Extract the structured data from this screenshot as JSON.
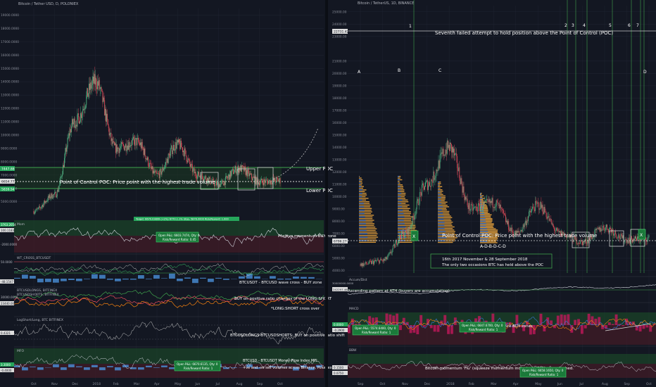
{
  "left_panel": {
    "symbol_title": "Bitcoin / Tether USD, D, POLONIEX",
    "price_ticks": [
      "19000.0000",
      "18000.0000",
      "17000.0000",
      "16000.0000",
      "15000.0000",
      "14000.0000",
      "13000.0000",
      "12000.0000",
      "11000.0000",
      "10000.0000",
      "9000.0000",
      "8000.0000",
      "7000.0000",
      "6000.0000",
      "5000.0000"
    ],
    "price_badges": [
      "7447.88",
      "6654.77",
      "5839.94"
    ],
    "x_ticks": [
      "Oct",
      "Nov",
      "Dec",
      "2018",
      "Feb",
      "Mar",
      "Apr",
      "May",
      "Jun",
      "Jul",
      "Aug",
      "Sep",
      "Oct"
    ],
    "poc_text": "Point of Control POC: Price point with the highest trade volume",
    "upper_poc": "Upper POC",
    "lower_poc": "Lower POC",
    "indicators": [
      {
        "title": "Mom",
        "badge": "3763.2054",
        "badge2": "100.1183",
        "left_tick": "-2000.0000",
        "note": "Positive momentum BUY zone",
        "box_lines": [
          "Open P&L: 6603.7474, Qty: 0",
          "Risk/Reward Ratio: 0.45"
        ],
        "top_note": "Target: 6670.03899 (+2%) 6770.1.1% Stop, 5876.0000 Risk/Reward: 1.000"
      },
      {
        "title": "WT_CROSS_BTCUSDT",
        "left_tick": "50.0000",
        "badge": "-48.1547",
        "note": "BTCUSDT - BTCUSD wave cross - BUY zone"
      },
      {
        "title": "BTCUSDLONGS, BITFINEX",
        "title2": "BTCUSDSHORTS, BITFINEX",
        "left_tick": "30000.0000",
        "badge": "23440.00",
        "note": "BUY on positive ratio changes of the LONG:SHORT",
        "note2": "*LONG:SHORT cross over"
      },
      {
        "title": "LogShort/Long, BTC BITFINEX",
        "badge": "0.4321",
        "note": "BTCUSDLONGS-BTCUSDSHORTS: BUY on positive ratio shift"
      },
      {
        "title": "MFO",
        "badge": "3.3000",
        "badge2": "-0.4000",
        "note": "BTCUSD - BTCUSDT Money Flow Index MFI",
        "note2": "+ve and -ve sell volumes across Binance, Poloniex, Bitfinex",
        "box_lines": [
          "Open P&L: 6670.6135, Qty: 0",
          "Risk/Reward Ratio: 1"
        ]
      }
    ]
  },
  "right_panel": {
    "symbol_title": "Bitcoin / TetherUS, 1D, BINANCE",
    "price_ticks": [
      "25000.00",
      "24000.00",
      "23000.00",
      "21000.00",
      "20000.00",
      "19000.00",
      "18000.00",
      "17000.00",
      "16000.00",
      "15000.00",
      "14000.00",
      "13000.00",
      "12000.00",
      "11000.00",
      "10000.00",
      "9000.00",
      "8000.00",
      "7000.00",
      "6000.00",
      "5000.00",
      "4000.00"
    ],
    "price_badges": [
      "22731.42",
      "6796.27"
    ],
    "x_ticks": [
      "Sep",
      "Oct",
      "Nov",
      "Dec",
      "2018",
      "Feb",
      "Mar",
      "Apr",
      "May",
      "Jun",
      "Jul",
      "Aug",
      "Sep",
      "Oct"
    ],
    "phase_letters": [
      "A",
      "B",
      "C",
      "D"
    ],
    "attempt_numbers": [
      "1",
      "2",
      "3",
      "4",
      "5",
      "6",
      "7"
    ],
    "seventh_text": "Seventh failed attempt to hold position above the Point of Control (POC)",
    "poc_text": "Point of Control POC: Price point with the highest trade volume",
    "sequence_text": "A-D-B-D-C-D",
    "box_text_1": "16th 2017 November & 28 September 2018",
    "box_text_2": "The only two occasions BTC has held above the POC",
    "x_marks": [
      "X",
      "X"
    ],
    "indicators": [
      {
        "title": "Accum/Dist",
        "left_tick": "30000000.0000",
        "badge": "242297.4611",
        "note": "Ascending pattern at ATH (buyers are accumulating)"
      },
      {
        "title": "MACD",
        "badge": "0.0000",
        "badge2": "-0.2900",
        "note": "Convergence BUY zones",
        "box_lines": [
          "Open P&L: 5574.6400, Qty: 0",
          "Risk/Reward Ratio: 1"
        ],
        "box2_lines": [
          "Open P&L: 6647.6700, Qty: 0",
          "Risk/Reward Ratio: 1"
        ]
      },
      {
        "title": "BBW",
        "badge": "0.1500",
        "badge2": "0.0750",
        "note": "Bitcoin momentum 'Fiu' (squeeze momentum indicator) - BUY zone reached.",
        "box_lines": [
          "Open P&L: 6658.1650, Qty: 0",
          "Risk/Reward Ratio: 1"
        ]
      }
    ]
  },
  "colors": {
    "background": "#131722",
    "grid": "#1e2330",
    "up_candle": "#53b987",
    "down_candle": "#eb4d5c",
    "volume_profile": "#e8a33d",
    "volume_profile_blue": "#3c78d8",
    "green_zone": "#1c4d2a",
    "red_zone": "#4d1c28",
    "poc_line": "#c8c8c8",
    "green_badge": "#26a65b",
    "text": "#d1d4dc"
  },
  "chart_data": [
    {
      "type": "line",
      "title": "Bitcoin / Tether USD, D, POLONIEX",
      "x": [
        "Oct",
        "Nov",
        "Dec",
        "2018",
        "Feb",
        "Mar",
        "Apr",
        "May",
        "Jun",
        "Jul",
        "Aug",
        "Sep",
        "Oct"
      ],
      "series": [
        {
          "values": [
            4300,
            5500,
            11000,
            14000,
            9000,
            9500,
            7000,
            9300,
            7000,
            6300,
            7500,
            6500,
            6600
          ]
        }
      ],
      "ylim": [
        4300,
        19500
      ]
    },
    {
      "type": "line",
      "title": "Bitcoin / TetherUS, 1D, BINANCE",
      "x": [
        "Sep",
        "Oct",
        "Nov",
        "Dec",
        "2018",
        "Feb",
        "Mar",
        "Apr",
        "May",
        "Jun",
        "Jul",
        "Aug",
        "Sep",
        "Oct"
      ],
      "series": [
        {
          "values": [
            4500,
            4800,
            7000,
            11000,
            14000,
            9000,
            9500,
            7000,
            9300,
            7000,
            6300,
            7500,
            6500,
            6600
          ]
        }
      ],
      "ylim": [
        3800,
        25500
      ]
    }
  ]
}
